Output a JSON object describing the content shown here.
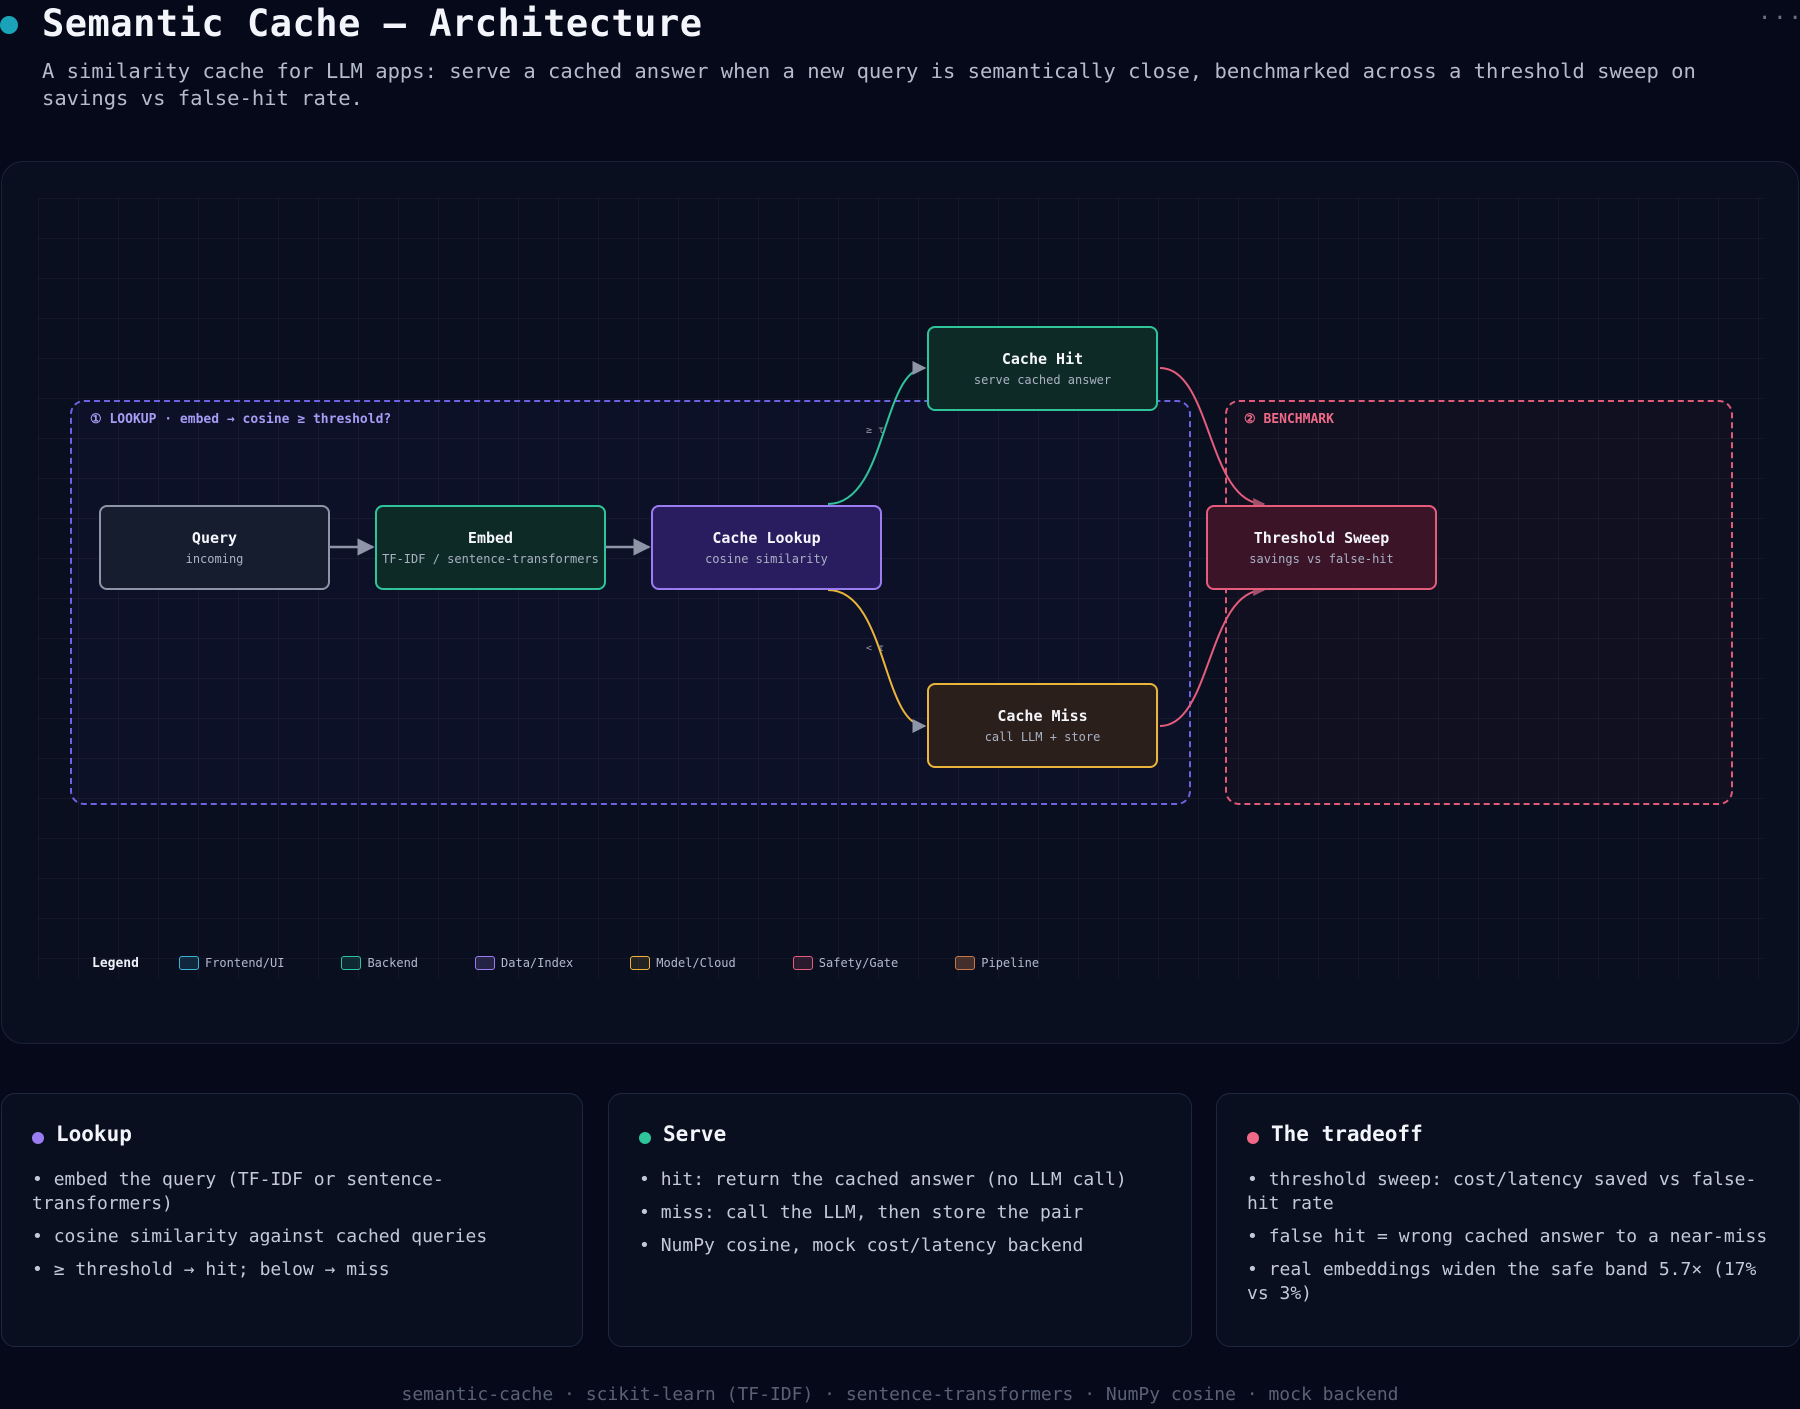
{
  "header": {
    "title": "Semantic Cache — Architecture",
    "subtitle": "A similarity cache for LLM apps: serve a cached answer when a new query is semantically close, benchmarked across a threshold sweep on savings vs false-hit rate.",
    "more_icon": "more-horizontal-icon",
    "title_dot_color": "#1aa3b8"
  },
  "diagram": {
    "groups": {
      "lookup": "① LOOKUP · embed → cosine ≥ threshold?",
      "benchmark": "② BENCHMARK"
    },
    "nodes": {
      "query": {
        "title": "Query",
        "subtitle": "incoming",
        "category": "Frontend/UI"
      },
      "embed": {
        "title": "Embed",
        "subtitle": "TF-IDF / sentence-transformers",
        "category": "Backend"
      },
      "lookup": {
        "title": "Cache Lookup",
        "subtitle": "cosine similarity",
        "category": "Data/Index"
      },
      "hit": {
        "title": "Cache Hit",
        "subtitle": "serve cached answer",
        "category": "Backend"
      },
      "miss": {
        "title": "Cache Miss",
        "subtitle": "call LLM + store",
        "category": "Model/Cloud"
      },
      "sweep": {
        "title": "Threshold Sweep",
        "subtitle": "savings vs false-hit",
        "category": "Safety/Gate"
      }
    },
    "edges": [
      {
        "from": "query",
        "to": "embed",
        "label": ""
      },
      {
        "from": "embed",
        "to": "lookup",
        "label": ""
      },
      {
        "from": "lookup",
        "to": "hit",
        "label": "≥ τ"
      },
      {
        "from": "lookup",
        "to": "miss",
        "label": "< τ"
      },
      {
        "from": "hit",
        "to": "sweep",
        "label": ""
      },
      {
        "from": "miss",
        "to": "sweep",
        "label": ""
      }
    ],
    "legend": {
      "title": "Legend",
      "items": [
        {
          "label": "Frontend/UI",
          "color": "#3fb3d6"
        },
        {
          "label": "Backend",
          "color": "#2fc49a"
        },
        {
          "label": "Data/Index",
          "color": "#9b7df2"
        },
        {
          "label": "Model/Cloud",
          "color": "#eab53a"
        },
        {
          "label": "Safety/Gate",
          "color": "#e65c7c"
        },
        {
          "label": "Pipeline",
          "color": "#c9784a"
        }
      ]
    }
  },
  "cards": [
    {
      "title": "Lookup",
      "dot_color": "#9b7df2",
      "items": [
        "embed the query (TF-IDF or sentence-transformers)",
        "cosine similarity against cached queries",
        "≥ threshold → hit; below → miss"
      ]
    },
    {
      "title": "Serve",
      "dot_color": "#2fc49a",
      "items": [
        "hit: return the cached answer (no LLM call)",
        "miss: call the LLM, then store the pair",
        "NumPy cosine, mock cost/latency backend"
      ]
    },
    {
      "title": "The tradeoff",
      "dot_color": "#f06a88",
      "items": [
        "threshold sweep: cost/latency saved vs false-hit rate",
        "false hit = wrong cached answer to a near-miss",
        "real embeddings widen the safe band 5.7× (17% vs 3%)"
      ]
    }
  ],
  "footer": "semantic-cache · scikit-learn (TF-IDF) · sentence-transformers · NumPy cosine · mock backend"
}
